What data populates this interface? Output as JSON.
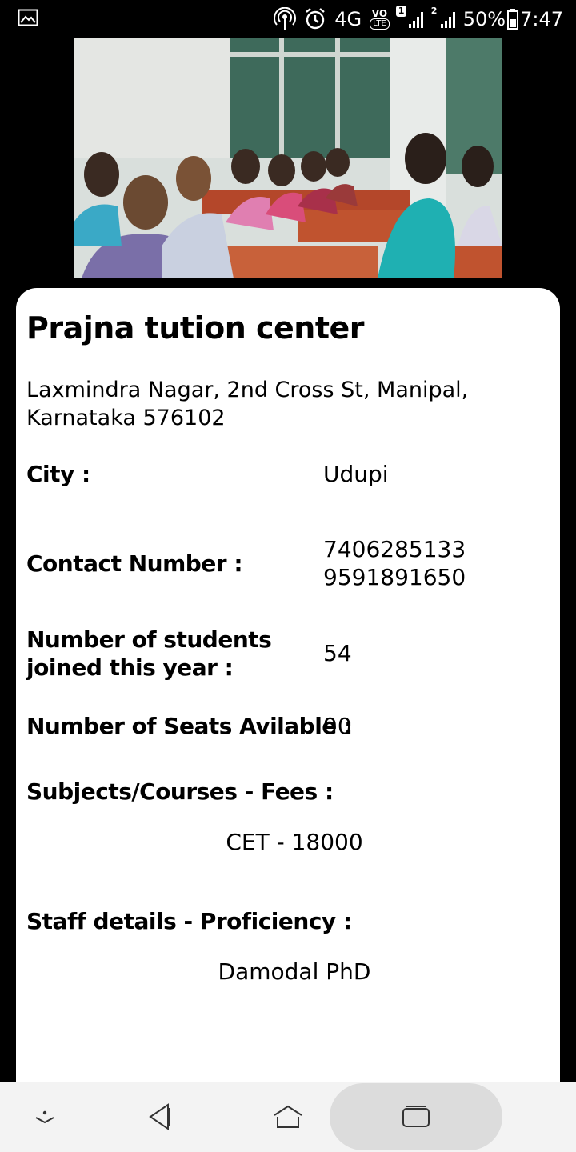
{
  "status_bar": {
    "icons": [
      "image-icon",
      "hotspot-icon",
      "alarm-icon",
      "volte-icon",
      "sim1-signal-icon",
      "sim2-signal-icon",
      "battery-icon"
    ],
    "network": "4G",
    "volte": "VO",
    "volte_sub": "LTE",
    "sim1_badge": "1",
    "sim2_badge": "2",
    "battery": "50%",
    "time": "7:47"
  },
  "center": {
    "name": "Prajna tution center",
    "address": "Laxmindra Nagar, 2nd Cross St, Manipal, Karnataka 576102",
    "city_label": "City :",
    "city": "Udupi",
    "contact_label": "Contact Number :",
    "contact_1": "7406285133",
    "contact_2": "9591891650",
    "students_label": "Number of students joined this year :",
    "students": "54",
    "seats_label": "Number of Seats Avilable :",
    "seats": "90",
    "subjects_label": "Subjects/Courses - Fees :",
    "subjects": "CET - 18000",
    "staff_label": "Staff details - Proficiency :",
    "staff": "Damodal PhD"
  },
  "nav_bar": {
    "icons": [
      "hide-keyboard-icon",
      "back-icon",
      "home-icon",
      "recents-icon"
    ]
  }
}
